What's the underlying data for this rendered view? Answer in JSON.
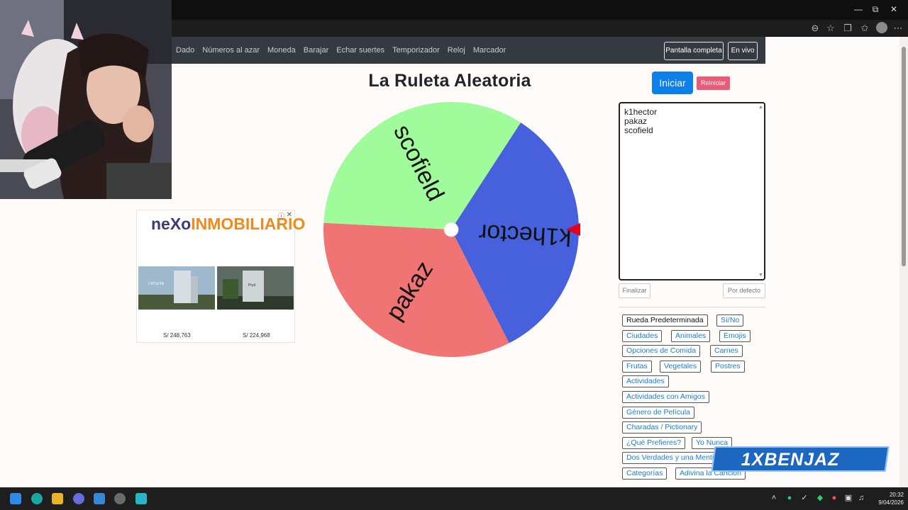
{
  "site_nav": {
    "links": [
      "Dado",
      "Números al azar",
      "Moneda",
      "Barajar",
      "Echar suertes",
      "Temporizador",
      "Reloj",
      "Marcador"
    ],
    "fullscreen_label": "Pantalla completa",
    "live_label": "En vivo"
  },
  "page_title": "La Ruleta Aleatoria",
  "wheel": {
    "segments": [
      {
        "label": "k1hector",
        "color": "#4761dc"
      },
      {
        "label": "pakaz",
        "color": "#f07474"
      },
      {
        "label": "scofield",
        "color": "#a0fb9a"
      }
    ],
    "pointer_color": "#e4001b"
  },
  "controls": {
    "start_label": "Iniciar",
    "reset_label": "Reiniciar",
    "finish_label": "Finalizar",
    "default_label": "Por defecto"
  },
  "names_text": [
    "k1hector",
    "pakaz",
    "scofield"
  ],
  "presets": [
    "Rueda Predeterminada",
    "Sí/No",
    "Ciudades",
    "Animales",
    "Emojis",
    "Opciones de Comida",
    "Carnes",
    "Frutas",
    "Vegetales",
    "Postres",
    "Actividades",
    "Actividades con Amigos",
    "Género de Película",
    "Charadas / Pictionary",
    "¿Qué Prefieres?",
    "Yo Nunca",
    "Dos Verdades y una Menti",
    "Categorías",
    "Adivina la Canción"
  ],
  "ad": {
    "logo_part1": "neXo",
    "logo_part2": "INMOBILIARIO",
    "img1_text": "CATLEYA",
    "img2_text": "Pryd",
    "price1": "S/ 248,763",
    "price2": "S/ 224,968"
  },
  "watermark": "1XBENJAZ",
  "taskbar": {
    "time": "20:32",
    "date": "9/04/2026"
  },
  "colors": {
    "accent": "#0d7fe8",
    "reset": "#e85c7a",
    "link": "#1b7ed3",
    "navbar": "#343a40"
  }
}
